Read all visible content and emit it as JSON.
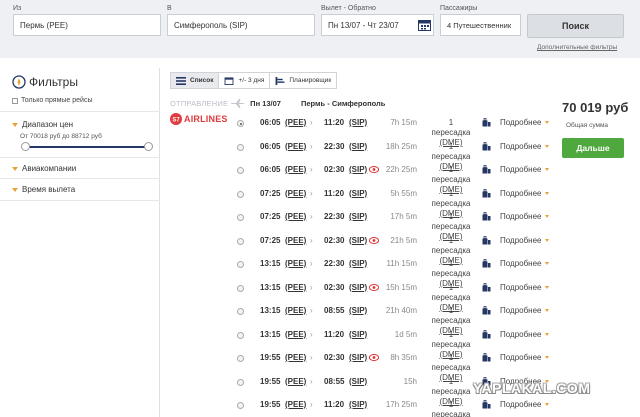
{
  "search": {
    "from_label": "Из",
    "from_value": "Пермь (PEE)",
    "to_label": "В",
    "to_value": "Симферополь (SIP)",
    "dates_label": "Вылет - Обратно",
    "dates_value": "Пн 13/07 - Чт 23/07",
    "pax_label": "Пассажиры",
    "pax_value": "4 Путешественник",
    "search_button": "Поиск",
    "advanced_link": "Дополнительные фильтры"
  },
  "filters": {
    "title": "Фильтры",
    "direct_only": "Только прямые рейсы",
    "price_section": "Диапазон цен",
    "price_range": "От 70018 руб до 88712 руб",
    "price_min": 70018,
    "price_max": 88712,
    "airlines_section": "Авиакомпании",
    "departure_section": "Время вылета"
  },
  "view_tabs": {
    "list": "Список",
    "plusminus": "+/- 3 дня",
    "planner": "Планировщик"
  },
  "direction": {
    "label": "ОТПРАВЛЕНИЕ",
    "date": "Пн 13/07",
    "route": "Пермь - Симферополь"
  },
  "airline": {
    "name": "AIRLINES",
    "logo_text": "S7",
    "color": "#e03a3e"
  },
  "offer": {
    "price": "70 019 руб",
    "total_label": "Общая сумма",
    "book_button": "Дальше"
  },
  "flights": [
    {
      "dep": "06:05",
      "dep_code": "(PEE)",
      "arr": "11:20",
      "arr_code": "(SIP)",
      "dur": "7h 15m",
      "stops": "1 пересадка",
      "via": "(DME)",
      "details": "Подробнее",
      "night": false,
      "selected": true
    },
    {
      "dep": "06:05",
      "dep_code": "(PEE)",
      "arr": "22:30",
      "arr_code": "(SIP)",
      "dur": "18h 25m",
      "stops": "1 пересадка",
      "via": "(DME)",
      "details": "Подробнее",
      "night": false,
      "selected": false
    },
    {
      "dep": "06:05",
      "dep_code": "(PEE)",
      "arr": "02:30",
      "arr_code": "(SIP)",
      "dur": "22h 25m",
      "stops": "1 пересадка",
      "via": "(DME)",
      "details": "Подробнее",
      "night": true,
      "selected": false
    },
    {
      "dep": "07:25",
      "dep_code": "(PEE)",
      "arr": "11:20",
      "arr_code": "(SIP)",
      "dur": "5h 55m",
      "stops": "1 пересадка",
      "via": "(DME)",
      "details": "Подробнее",
      "night": false,
      "selected": false
    },
    {
      "dep": "07:25",
      "dep_code": "(PEE)",
      "arr": "22:30",
      "arr_code": "(SIP)",
      "dur": "17h 5m",
      "stops": "1 пересадка",
      "via": "(DME)",
      "details": "Подробнее",
      "night": false,
      "selected": false
    },
    {
      "dep": "07:25",
      "dep_code": "(PEE)",
      "arr": "02:30",
      "arr_code": "(SIP)",
      "dur": "21h 5m",
      "stops": "1 пересадка",
      "via": "(DME)",
      "details": "Подробнее",
      "night": true,
      "selected": false
    },
    {
      "dep": "13:15",
      "dep_code": "(PEE)",
      "arr": "22:30",
      "arr_code": "(SIP)",
      "dur": "11h 15m",
      "stops": "1 пересадка",
      "via": "(DME)",
      "details": "Подробнее",
      "night": false,
      "selected": false
    },
    {
      "dep": "13:15",
      "dep_code": "(PEE)",
      "arr": "02:30",
      "arr_code": "(SIP)",
      "dur": "15h 15m",
      "stops": "1 пересадка",
      "via": "(DME)",
      "details": "Подробнее",
      "night": true,
      "selected": false
    },
    {
      "dep": "13:15",
      "dep_code": "(PEE)",
      "arr": "08:55",
      "arr_code": "(SIP)",
      "dur": "21h 40m",
      "stops": "1 пересадка",
      "via": "(DME)",
      "details": "Подробнее",
      "night": false,
      "selected": false
    },
    {
      "dep": "13:15",
      "dep_code": "(PEE)",
      "arr": "11:20",
      "arr_code": "(SIP)",
      "dur": "1d 5m",
      "stops": "1 пересадка",
      "via": "(DME)",
      "details": "Подробнее",
      "night": false,
      "selected": false
    },
    {
      "dep": "19:55",
      "dep_code": "(PEE)",
      "arr": "02:30",
      "arr_code": "(SIP)",
      "dur": "8h 35m",
      "stops": "1 пересадка",
      "via": "(DME)",
      "details": "Подробнее",
      "night": true,
      "selected": false
    },
    {
      "dep": "19:55",
      "dep_code": "(PEE)",
      "arr": "08:55",
      "arr_code": "(SIP)",
      "dur": "15h",
      "stops": "1 пересадка",
      "via": "(DME)",
      "details": "Подробнее",
      "night": false,
      "selected": false
    },
    {
      "dep": "19:55",
      "dep_code": "(PEE)",
      "arr": "11:20",
      "arr_code": "(SIP)",
      "dur": "17h 25m",
      "stops": "1 пересадка",
      "via": "(DME)",
      "details": "Подробнее",
      "night": false,
      "selected": false
    }
  ],
  "watermark": "YAPLAKAL.COM",
  "colors": {
    "accent_green": "#4fa83d",
    "airline_red": "#e03a3e",
    "slider_navy": "#253764",
    "arrow_orange": "#e8a33a"
  }
}
